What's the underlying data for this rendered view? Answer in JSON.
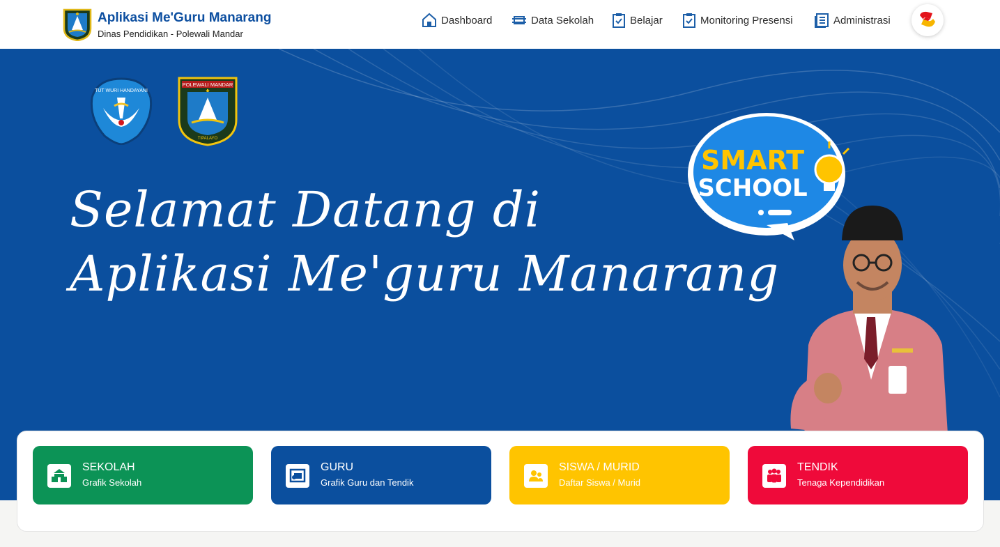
{
  "brand": {
    "title": "Aplikasi Me'Guru Manarang",
    "subtitle": "Dinas Pendidikan - Polewali Mandar"
  },
  "nav": [
    {
      "label": "Dashboard",
      "icon": "home-icon"
    },
    {
      "label": "Data Sekolah",
      "icon": "building-icon"
    },
    {
      "label": "Belajar",
      "icon": "clipboard-check-icon"
    },
    {
      "label": "Monitoring Presensi",
      "icon": "clipboard-check-icon"
    },
    {
      "label": "Administrasi",
      "icon": "document-list-icon"
    }
  ],
  "hero": {
    "title_line1": "Selamat Datang di",
    "title_line2": "Aplikasi Me'guru Manarang",
    "logo_left_text": "TUT WURI HANDAYANI",
    "logo_right_text": "POLEWALI MANDAR",
    "logo_right_motto": "TIPALAYO",
    "badge_line1": "SMART",
    "badge_line2": "SCHOOL"
  },
  "cards": [
    {
      "title": "SEKOLAH",
      "subtitle": "Grafik Sekolah",
      "icon": "school-icon",
      "color": "#0c9356"
    },
    {
      "title": "GURU",
      "subtitle": "Grafik Guru dan Tendik",
      "icon": "teacher-board-icon",
      "color": "#0b4f9e"
    },
    {
      "title": "SISWA / MURID",
      "subtitle": "Daftar Siswa / Murid",
      "icon": "users-icon",
      "color": "#ffc400"
    },
    {
      "title": "TENDIK",
      "subtitle": "Tenaga Kependidikan",
      "icon": "group-icon",
      "color": "#ef0a3a"
    }
  ],
  "colors": {
    "primary": "#0b4f9e",
    "brand_text": "#0d4fa0",
    "badge_yellow": "#ffc400"
  }
}
